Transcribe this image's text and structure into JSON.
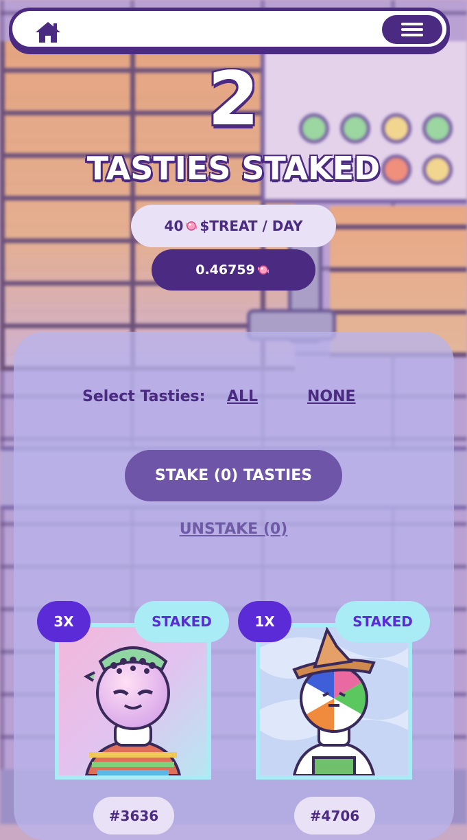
{
  "nav": {
    "home_icon": "home-icon",
    "menu_icon": "hamburger-menu-icon"
  },
  "stats": {
    "staked_count": "2",
    "staked_label": "TASTIES STAKED",
    "rate_amount": "40",
    "rate_unit": "$TREAT / DAY",
    "balance": "0.46759"
  },
  "controls": {
    "select_label": "Select Tasties:",
    "select_all": "ALL",
    "select_none": "NONE",
    "stake_button": "STAKE (0) TASTIES",
    "unstake_link": "UNSTAKE (0)"
  },
  "tokens": [
    {
      "multiplier": "3X",
      "status": "STAKED",
      "id": "#3636"
    },
    {
      "multiplier": "1X",
      "status": "STAKED",
      "id": "#4706"
    }
  ],
  "colors": {
    "primary": "#4b2a82",
    "accent": "#5a2bd6",
    "badge": "#a9ecf5",
    "pill_light": "#e9e2f7"
  }
}
